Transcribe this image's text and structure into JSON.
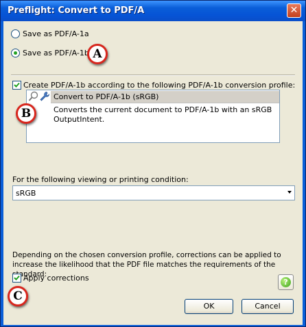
{
  "window": {
    "title": "Preflight: Convert to PDF/A",
    "close_glyph": "✕"
  },
  "options": {
    "radio_a1a": {
      "label": "Save as PDF/A-1a",
      "checked": false
    },
    "radio_a1b": {
      "label": "Save as PDF/A-1b",
      "checked": true
    }
  },
  "profile": {
    "checkbox_label": "Create PDF/A-1b according to the following PDF/A-1b conversion profile:",
    "checked": true,
    "selected_name": "Convert to PDF/A-1b (sRGB)",
    "description": "Converts the current document to PDF/A-1b with an sRGB OutputIntent.",
    "icons": [
      "magnifier-icon",
      "wrench-icon"
    ]
  },
  "condition": {
    "label": "For the following viewing or printing condition:",
    "selected": "sRGB"
  },
  "corrections": {
    "info": "Depending on the chosen conversion profile, corrections can be applied to increase the likelihood that the PDF file matches the requirements of the standard:",
    "checkbox_label": "Apply corrections",
    "checked": true
  },
  "buttons": {
    "ok": "OK",
    "cancel": "Cancel",
    "help": "?"
  },
  "callouts": {
    "a": "A",
    "b": "B",
    "c": "C"
  },
  "colors": {
    "titlebar": "#0a5ed8",
    "dialog_bg": "#ece9d8",
    "callout_border": "#d8261d",
    "radio_dot": "#21a121"
  }
}
